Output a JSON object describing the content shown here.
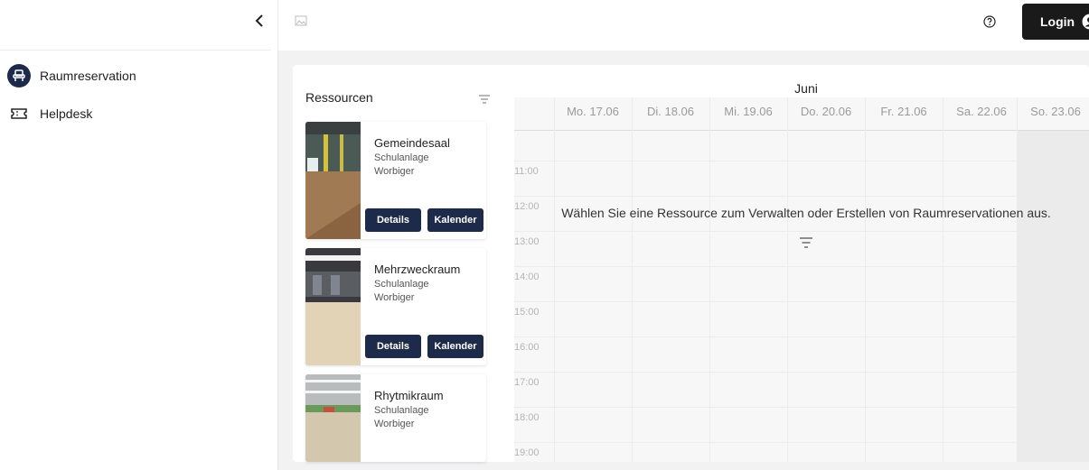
{
  "sidebar": {
    "collapse_icon": "chevron-left-icon",
    "items": [
      {
        "label": "Raumreservation",
        "icon": "armchair-icon",
        "active": true
      },
      {
        "label": "Helpdesk",
        "icon": "ticket-icon",
        "active": false
      }
    ]
  },
  "topbar": {
    "logo_icon": "image-placeholder-icon",
    "help_icon": "help-circle-icon",
    "login_label": "Login",
    "login_icon": "user-circle-icon"
  },
  "resources": {
    "title": "Ressourcen",
    "filter_icon": "filter-icon",
    "items": [
      {
        "name": "Gemeindesaal",
        "line1": "Schulanlage",
        "line2": "Worbiger",
        "details_label": "Details",
        "calendar_label": "Kalender"
      },
      {
        "name": "Mehrzweckraum",
        "line1": "Schulanlage",
        "line2": "Worbiger",
        "details_label": "Details",
        "calendar_label": "Kalender"
      },
      {
        "name": "Rhytmikraum",
        "line1": "Schulanlage",
        "line2": "Worbiger"
      }
    ]
  },
  "calendar": {
    "month": "Juni",
    "days": [
      "Mo. 17.06",
      "Di. 18.06",
      "Mi. 19.06",
      "Do. 20.06",
      "Fr. 21.06",
      "Sa. 22.06",
      "So. 23.06"
    ],
    "hours": [
      "11:00",
      "12:00",
      "13:00",
      "14:00",
      "15:00",
      "16:00",
      "17:00",
      "18:00",
      "19:00"
    ],
    "empty_message": "Wählen Sie eine Ressource zum Verwalten oder Erstellen von Raumreservationen aus.",
    "empty_icon": "filter-icon"
  },
  "colors": {
    "primary": "#1d2a4a",
    "login_bg": "#1a1a1a"
  }
}
